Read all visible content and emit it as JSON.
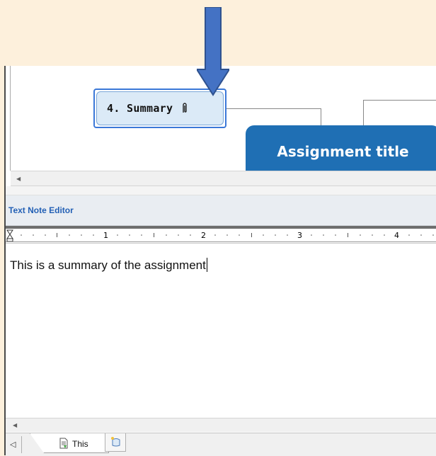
{
  "map": {
    "topic_summary_label": "4. Summary",
    "central_topic_label": "Assignment title"
  },
  "panel": {
    "title": "Text Note Editor"
  },
  "ruler": {
    "numbers": [
      "1",
      "2",
      "3",
      "4"
    ]
  },
  "editor": {
    "content": "This is a summary of the assignment"
  },
  "tabs": {
    "active_label": "This"
  },
  "colors": {
    "background": "#fdf0dc",
    "arrow": "#4472c4",
    "central_topic": "#1f6fb4",
    "topic_fill": "#dbeaf7",
    "panel_title": "#2360b5"
  },
  "icons": {
    "arrow": "down-arrow-icon",
    "attachment": "paperclip-icon",
    "tab": "note-page-icon",
    "new_tab": "new-note-icon"
  }
}
